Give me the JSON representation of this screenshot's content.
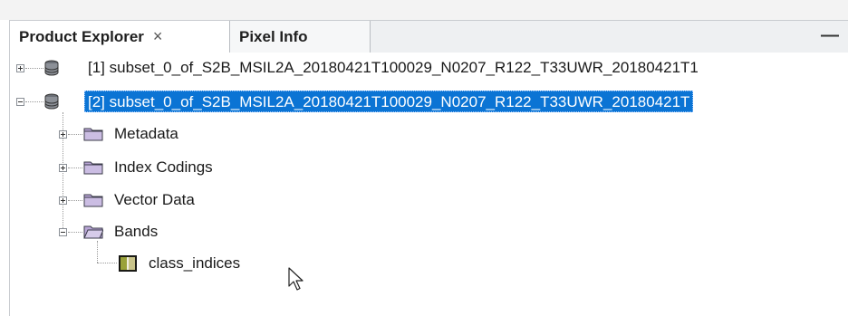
{
  "tabs": [
    {
      "label": "Product Explorer",
      "close": "×",
      "active": true
    },
    {
      "label": "Pixel Info",
      "active": false
    }
  ],
  "window_controls": {
    "minimize": "—"
  },
  "tree": {
    "products": [
      {
        "label": "[1] subset_0_of_S2B_MSIL2A_20180421T100029_N0207_R122_T33UWR_20180421T1",
        "expanded": false,
        "selected": false
      },
      {
        "label": "[2] subset_0_of_S2B_MSIL2A_20180421T100029_N0207_R122_T33UWR_20180421T",
        "expanded": true,
        "selected": true
      }
    ],
    "groups": [
      {
        "label": "Metadata",
        "expanded": false
      },
      {
        "label": "Index Codings",
        "expanded": false
      },
      {
        "label": "Vector Data",
        "expanded": false
      },
      {
        "label": "Bands",
        "expanded": true
      }
    ],
    "bands": [
      {
        "label": "class_indices"
      }
    ]
  },
  "colors": {
    "selection": "#0b74d4",
    "folder": "#b9a6d6"
  },
  "icons": [
    "database-icon",
    "folder-icon",
    "band-icon",
    "mouse-cursor-icon"
  ]
}
